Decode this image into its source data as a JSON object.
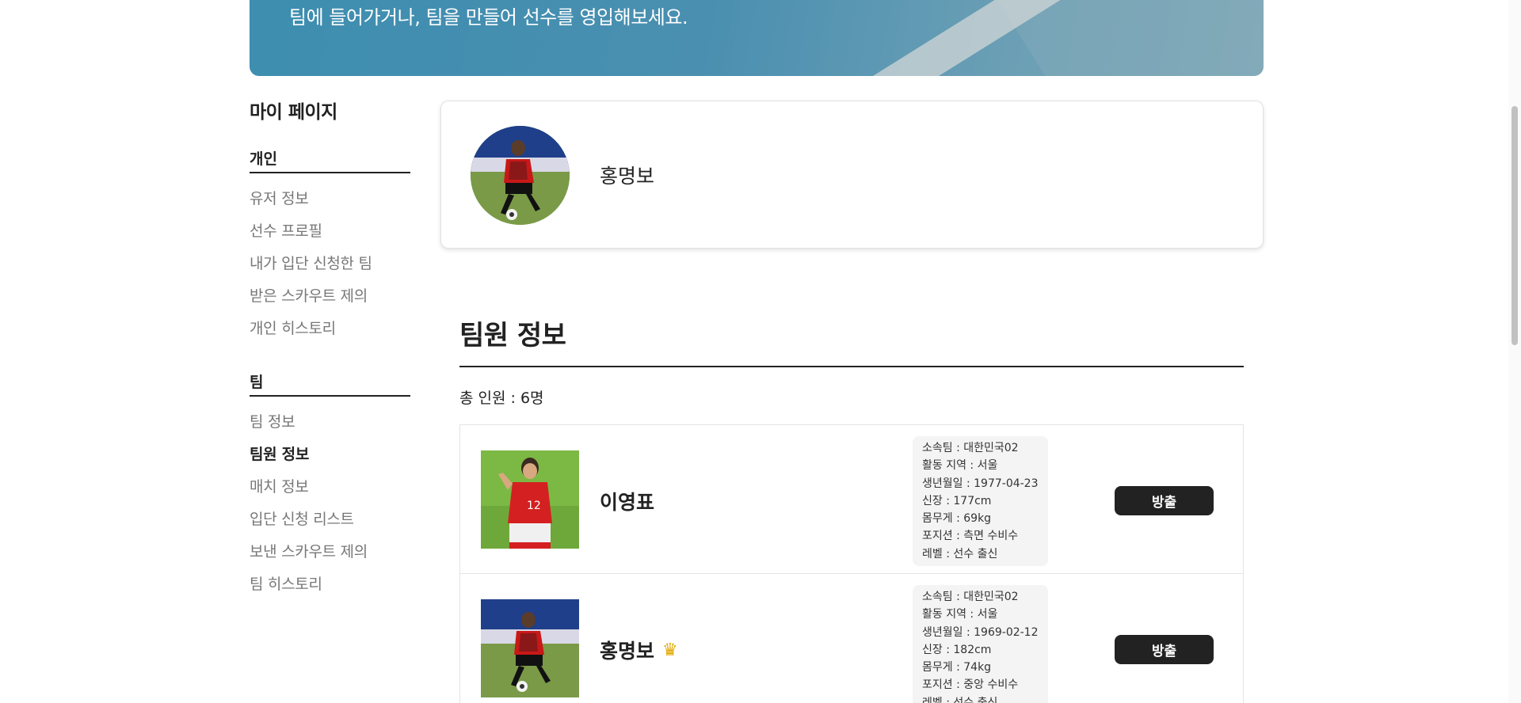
{
  "banner": {
    "text": "팀에 들어가거나, 팀을 만들어 선수를 영입해보세요."
  },
  "sidebar": {
    "title": "마이 페이지",
    "sections": [
      {
        "heading": "개인",
        "items": [
          "유저 정보",
          "선수 프로필",
          "내가 입단 신청한 팀",
          "받은 스카우트 제의",
          "개인 히스토리"
        ]
      },
      {
        "heading": "팀",
        "items": [
          "팀 정보",
          "팀원 정보",
          "매치 정보",
          "입단 신청 리스트",
          "보낸 스카우트 제의",
          "팀 히스토리"
        ],
        "active": "팀원 정보"
      }
    ]
  },
  "profile": {
    "name": "홍명보",
    "avatar_icon": "player-photo-icon"
  },
  "members": {
    "title": "팀원 정보",
    "count_label": "총 인원 : 6명",
    "kick_label": "방출",
    "list": [
      {
        "name": "이영표",
        "is_captain": false,
        "info": [
          "소속팀 : 대한민국02",
          "활동 지역 : 서울",
          "생년월일 : 1977-04-23",
          "신장 : 177cm",
          "몸무게 : 69kg",
          "포지션 : 측면 수비수",
          "레벨 : 선수 출신"
        ]
      },
      {
        "name": "홍명보",
        "is_captain": true,
        "captain_icon": "crown-icon",
        "info": [
          "소속팀 : 대한민국02",
          "활동 지역 : 서울",
          "생년월일 : 1969-02-12",
          "신장 : 182cm",
          "몸무게 : 74kg",
          "포지션 : 중앙 수비수",
          "레벨 : 선수 출신"
        ]
      }
    ]
  },
  "colors": {
    "banner_blue": "#4a8fb0",
    "button_dark": "#222222",
    "muted_text": "#777777"
  }
}
